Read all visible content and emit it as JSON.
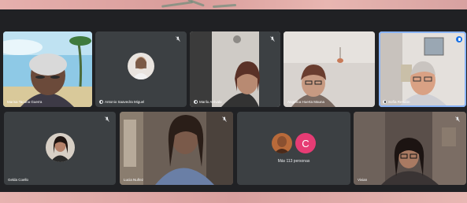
{
  "tiles": [
    {
      "name": "Marisa Tacuna Guerra"
    },
    {
      "name": "Antonio Saavedra Miguel"
    },
    {
      "name": "Marilu Arévalo"
    },
    {
      "name": "Angelica Huerta Mauna"
    },
    {
      "name": "Sofía Rendón"
    },
    {
      "name": "Gelda Coello"
    },
    {
      "name": "Lucia Nuñez"
    },
    {
      "name": ""
    },
    {
      "name": "Vivian"
    }
  ],
  "more": {
    "label": "Más 113 personas",
    "letter": "C"
  },
  "colors": {
    "stage": "#202124",
    "tile": "#3c4043",
    "accent": "#8ab4f8",
    "letter_avatar": "#e63c74"
  }
}
